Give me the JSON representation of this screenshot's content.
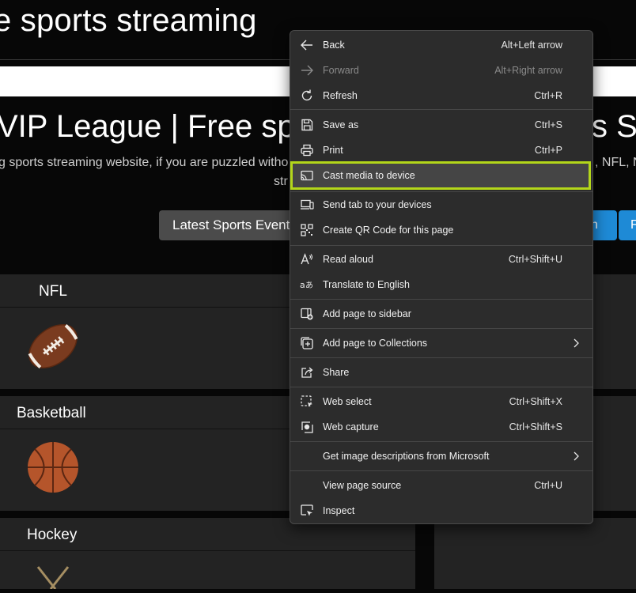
{
  "page": {
    "site_title": "e sports streaming",
    "hero_title": "VIP League | Free spo",
    "hero_title_tail": "s St",
    "hero_desc": "g sports streaming website, if you are puzzled witho",
    "hero_desc_tail": ", NFL, N",
    "hero_desc_line2": "str",
    "btn_latest": "Latest Sports Events",
    "btn_blue1": "n",
    "btn_blue2": "F",
    "cards": [
      {
        "label": "NFL",
        "icon": "football-icon"
      },
      {
        "label": "Basketball",
        "icon": "basketball-icon"
      },
      {
        "label": "Hockey",
        "icon": "hockey-sticks-icon"
      }
    ]
  },
  "menu": {
    "items": [
      {
        "id": "back",
        "label": "Back",
        "shortcut": "Alt+Left arrow",
        "icon": "back-arrow-icon"
      },
      {
        "id": "forward",
        "label": "Forward",
        "shortcut": "Alt+Right arrow",
        "icon": "forward-arrow-icon",
        "disabled": true
      },
      {
        "id": "refresh",
        "label": "Refresh",
        "shortcut": "Ctrl+R",
        "icon": "refresh-icon"
      },
      {
        "id": "save-as",
        "label": "Save as",
        "shortcut": "Ctrl+S",
        "icon": "save-icon"
      },
      {
        "id": "print",
        "label": "Print",
        "shortcut": "Ctrl+P",
        "icon": "printer-icon"
      },
      {
        "id": "cast",
        "label": "Cast media to device",
        "shortcut": "",
        "icon": "cast-icon",
        "highlighted": true
      },
      {
        "id": "send-tab",
        "label": "Send tab to your devices",
        "shortcut": "",
        "icon": "devices-icon"
      },
      {
        "id": "qr",
        "label": "Create QR Code for this page",
        "shortcut": "",
        "icon": "qr-code-icon"
      },
      {
        "id": "read-aloud",
        "label": "Read aloud",
        "shortcut": "Ctrl+Shift+U",
        "icon": "read-aloud-icon"
      },
      {
        "id": "translate",
        "label": "Translate to English",
        "shortcut": "",
        "icon": "translate-icon"
      },
      {
        "id": "sidebar",
        "label": "Add page to sidebar",
        "shortcut": "",
        "icon": "add-sidebar-icon"
      },
      {
        "id": "collections",
        "label": "Add page to Collections",
        "shortcut": "",
        "icon": "collections-icon",
        "submenu": true
      },
      {
        "id": "share",
        "label": "Share",
        "shortcut": "",
        "icon": "share-icon"
      },
      {
        "id": "web-select",
        "label": "Web select",
        "shortcut": "Ctrl+Shift+X",
        "icon": "web-select-icon"
      },
      {
        "id": "web-capture",
        "label": "Web capture",
        "shortcut": "Ctrl+Shift+S",
        "icon": "web-capture-icon"
      },
      {
        "id": "image-desc",
        "label": "Get image descriptions from Microsoft",
        "shortcut": "",
        "icon": "",
        "submenu": true
      },
      {
        "id": "view-source",
        "label": "View page source",
        "shortcut": "Ctrl+U",
        "icon": ""
      },
      {
        "id": "inspect",
        "label": "Inspect",
        "shortcut": "",
        "icon": "inspect-icon"
      }
    ]
  },
  "colors": {
    "highlight_outline": "#b3d61a",
    "menu_bg": "#2c2c2c",
    "button_blue": "#1e8ad6"
  }
}
